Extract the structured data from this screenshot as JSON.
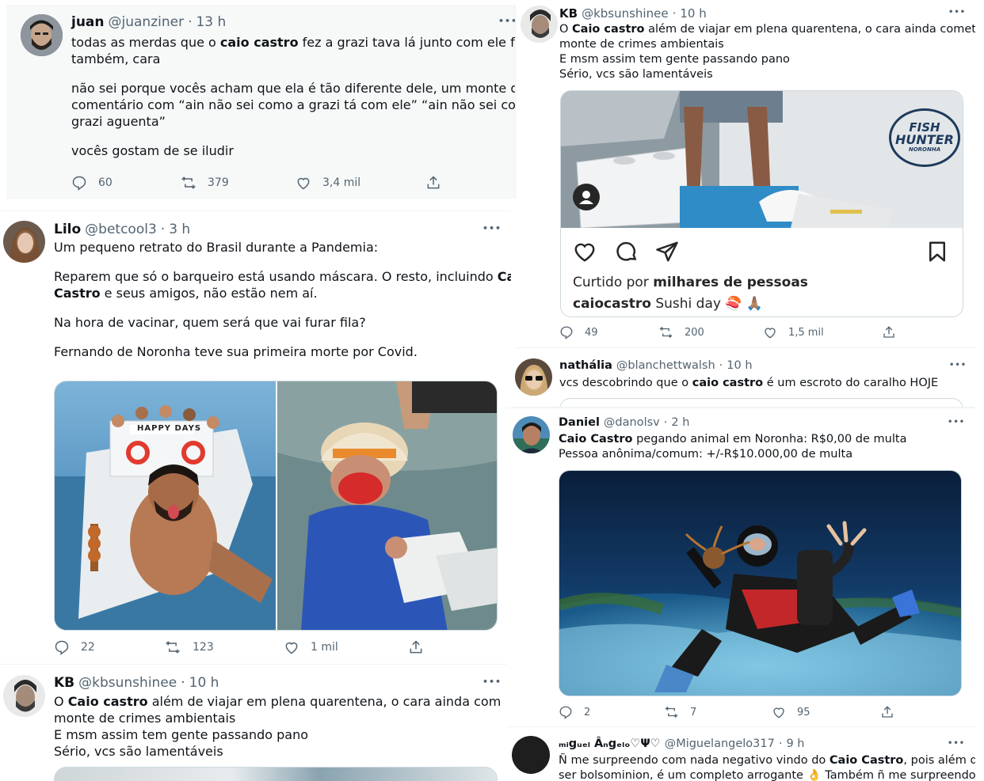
{
  "tweets": {
    "t1": {
      "name": "juan",
      "handle": "@juanziner",
      "dot": "·",
      "time": "13 h",
      "more": "•••",
      "lines": {
        "l1a": "todas as merdas que o ",
        "l1b": "caio castro",
        "l1c": " fez a grazi tava lá junto com ele fazendo",
        "l2": "também, cara",
        "l3": "não sei porque vocês acham que ela é tão diferente dele, um monte de",
        "l4": "comentário com “ain não sei como a grazi tá com ele” “ain não sei como a",
        "l5": "grazi aguenta”",
        "l6": "vocês gostam de se iludir"
      },
      "replies": "60",
      "retweets": "379",
      "likes": "3,4 mil"
    },
    "t2": {
      "name": "Lilo",
      "handle": "@betcool3",
      "dot": "·",
      "time": "3 h",
      "more": "•••",
      "lines": {
        "l1": "Um pequeno retrato do Brasil durante a Pandemia:",
        "l2a": "Reparem que só o barqueiro está usando máscara. O resto, incluindo ",
        "l2b": "Caio",
        "l3a": "Castro",
        "l3b": " e seus amigos, não estão nem aí.",
        "l4": "Na hora de vacinar, quem será que vai furar fila?",
        "l5": "Fernando de Noronha teve sua primeira morte por Covid."
      },
      "boat_sign": "HAPPY DAYS",
      "replies": "22",
      "retweets": "123",
      "likes": "1 mil"
    },
    "t3": {
      "name": "KB",
      "handle": "@kbsunshinee",
      "dot": "·",
      "time": "10 h",
      "more": "•••",
      "lines": {
        "l1a": "O ",
        "l1b": "Caio castro",
        "l1c": " além de viajar em plena quarentena, o cara ainda comete um",
        "l2": "monte de crimes ambientais",
        "l3": "E msm assim tem gente passando pano",
        "l4": "Sério, vcs são lamentáveis"
      }
    },
    "t4": {
      "name": "KB",
      "handle": "@kbsunshinee",
      "dot": "·",
      "time": "10 h",
      "more": "•••",
      "lines": {
        "l1a": "O ",
        "l1b": "Caio castro",
        "l1c": " além de viajar em plena quarentena, o cara ainda comete um",
        "l2": "monte de crimes ambientais",
        "l3": "E msm assim tem gente passando pano",
        "l4": "Sério, vcs são lamentáveis"
      },
      "ig": {
        "brand1": "FISH",
        "brand2": "HUNTER",
        "brand3": "NORONHA",
        "liked_prefix": "Curtido por ",
        "liked_bold": "milhares de pessoas",
        "user": "caiocastro",
        "caption": " Sushi day 🍣 🙏🏽"
      },
      "replies": "49",
      "retweets": "200",
      "likes": "1,5 mil"
    },
    "t5": {
      "name": "nathália",
      "handle": "@blanchettwalsh",
      "dot": "·",
      "time": "10 h",
      "more": "•••",
      "lines": {
        "l1a": "vcs descobrindo que o ",
        "l1b": "caio castro",
        "l1c": " é um escroto do caralho HOJE"
      }
    },
    "t6": {
      "name": "Daniel",
      "handle": "@danolsv",
      "dot": "·",
      "time": "2 h",
      "more": "•••",
      "lines": {
        "l1a": "Caio Castro",
        "l1b": " pegando animal em Noronha: R$0,00 de multa",
        "l2": "Pessoa anônima/comum: +/-R$10.000,00 de multa"
      },
      "replies": "2",
      "retweets": "7",
      "likes": "95"
    },
    "t7": {
      "name": "ₘᵢgᵤₑₗ Âₙgₑₗₒ♡Ψ♡",
      "handle": "@Miguelangelo317",
      "dot": "·",
      "time": "9 h",
      "more": "•••",
      "lines": {
        "l1a": "Ñ me surpreendo com nada negativo vindo do ",
        "l1b": "Caio Castro",
        "l1c": ", pois além de",
        "l2": "ser bolsominion, é um completo arrogante 👌 Também ñ me surpreendo"
      }
    }
  },
  "colors": {
    "text": "#0f1419",
    "muted": "#536471",
    "border": "#cfd9de",
    "bg": "#ffffff",
    "bg_light": "#f7f9f9"
  },
  "icons": [
    "reply-icon",
    "retweet-icon",
    "like-icon",
    "share-icon",
    "more-icon",
    "instagram-heart-icon",
    "instagram-comment-icon",
    "instagram-send-icon",
    "instagram-save-icon",
    "instagram-user-icon"
  ]
}
